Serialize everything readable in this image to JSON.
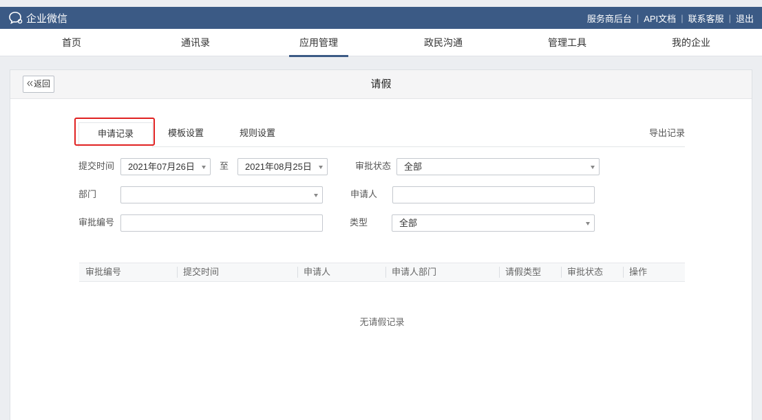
{
  "brand": {
    "name": "企业微信",
    "logo_icon": "chat-bubble-icon"
  },
  "top_links": [
    "服务商后台",
    "API文档",
    "联系客服",
    "退出"
  ],
  "nav": {
    "items": [
      "首页",
      "通讯录",
      "应用管理",
      "政民沟通",
      "管理工具",
      "我的企业"
    ],
    "active_index": 2
  },
  "panel": {
    "back_label": "返回",
    "back_icon": "double-chevron-left-icon",
    "title": "请假"
  },
  "tabs": {
    "items": [
      "申请记录",
      "模板设置",
      "规则设置"
    ],
    "active_index": 0,
    "export_label": "导出记录"
  },
  "filters": {
    "submit_time_label": "提交时间",
    "date_from": "2021年07月26日",
    "to_label": "至",
    "date_to": "2021年08月25日",
    "status_label": "审批状态",
    "status_value": "全部",
    "dept_label": "部门",
    "dept_value": "",
    "applicant_label": "申请人",
    "applicant_value": "",
    "approval_no_label": "审批编号",
    "approval_no_value": "",
    "type_label": "类型",
    "type_value": "全部"
  },
  "table": {
    "columns": [
      "审批编号",
      "提交时间",
      "申请人",
      "申请人部门",
      "请假类型",
      "审批状态",
      "操作"
    ],
    "empty_text": "无请假记录"
  },
  "colors": {
    "topbar": "#3b5a85",
    "highlight": "#e02020"
  }
}
